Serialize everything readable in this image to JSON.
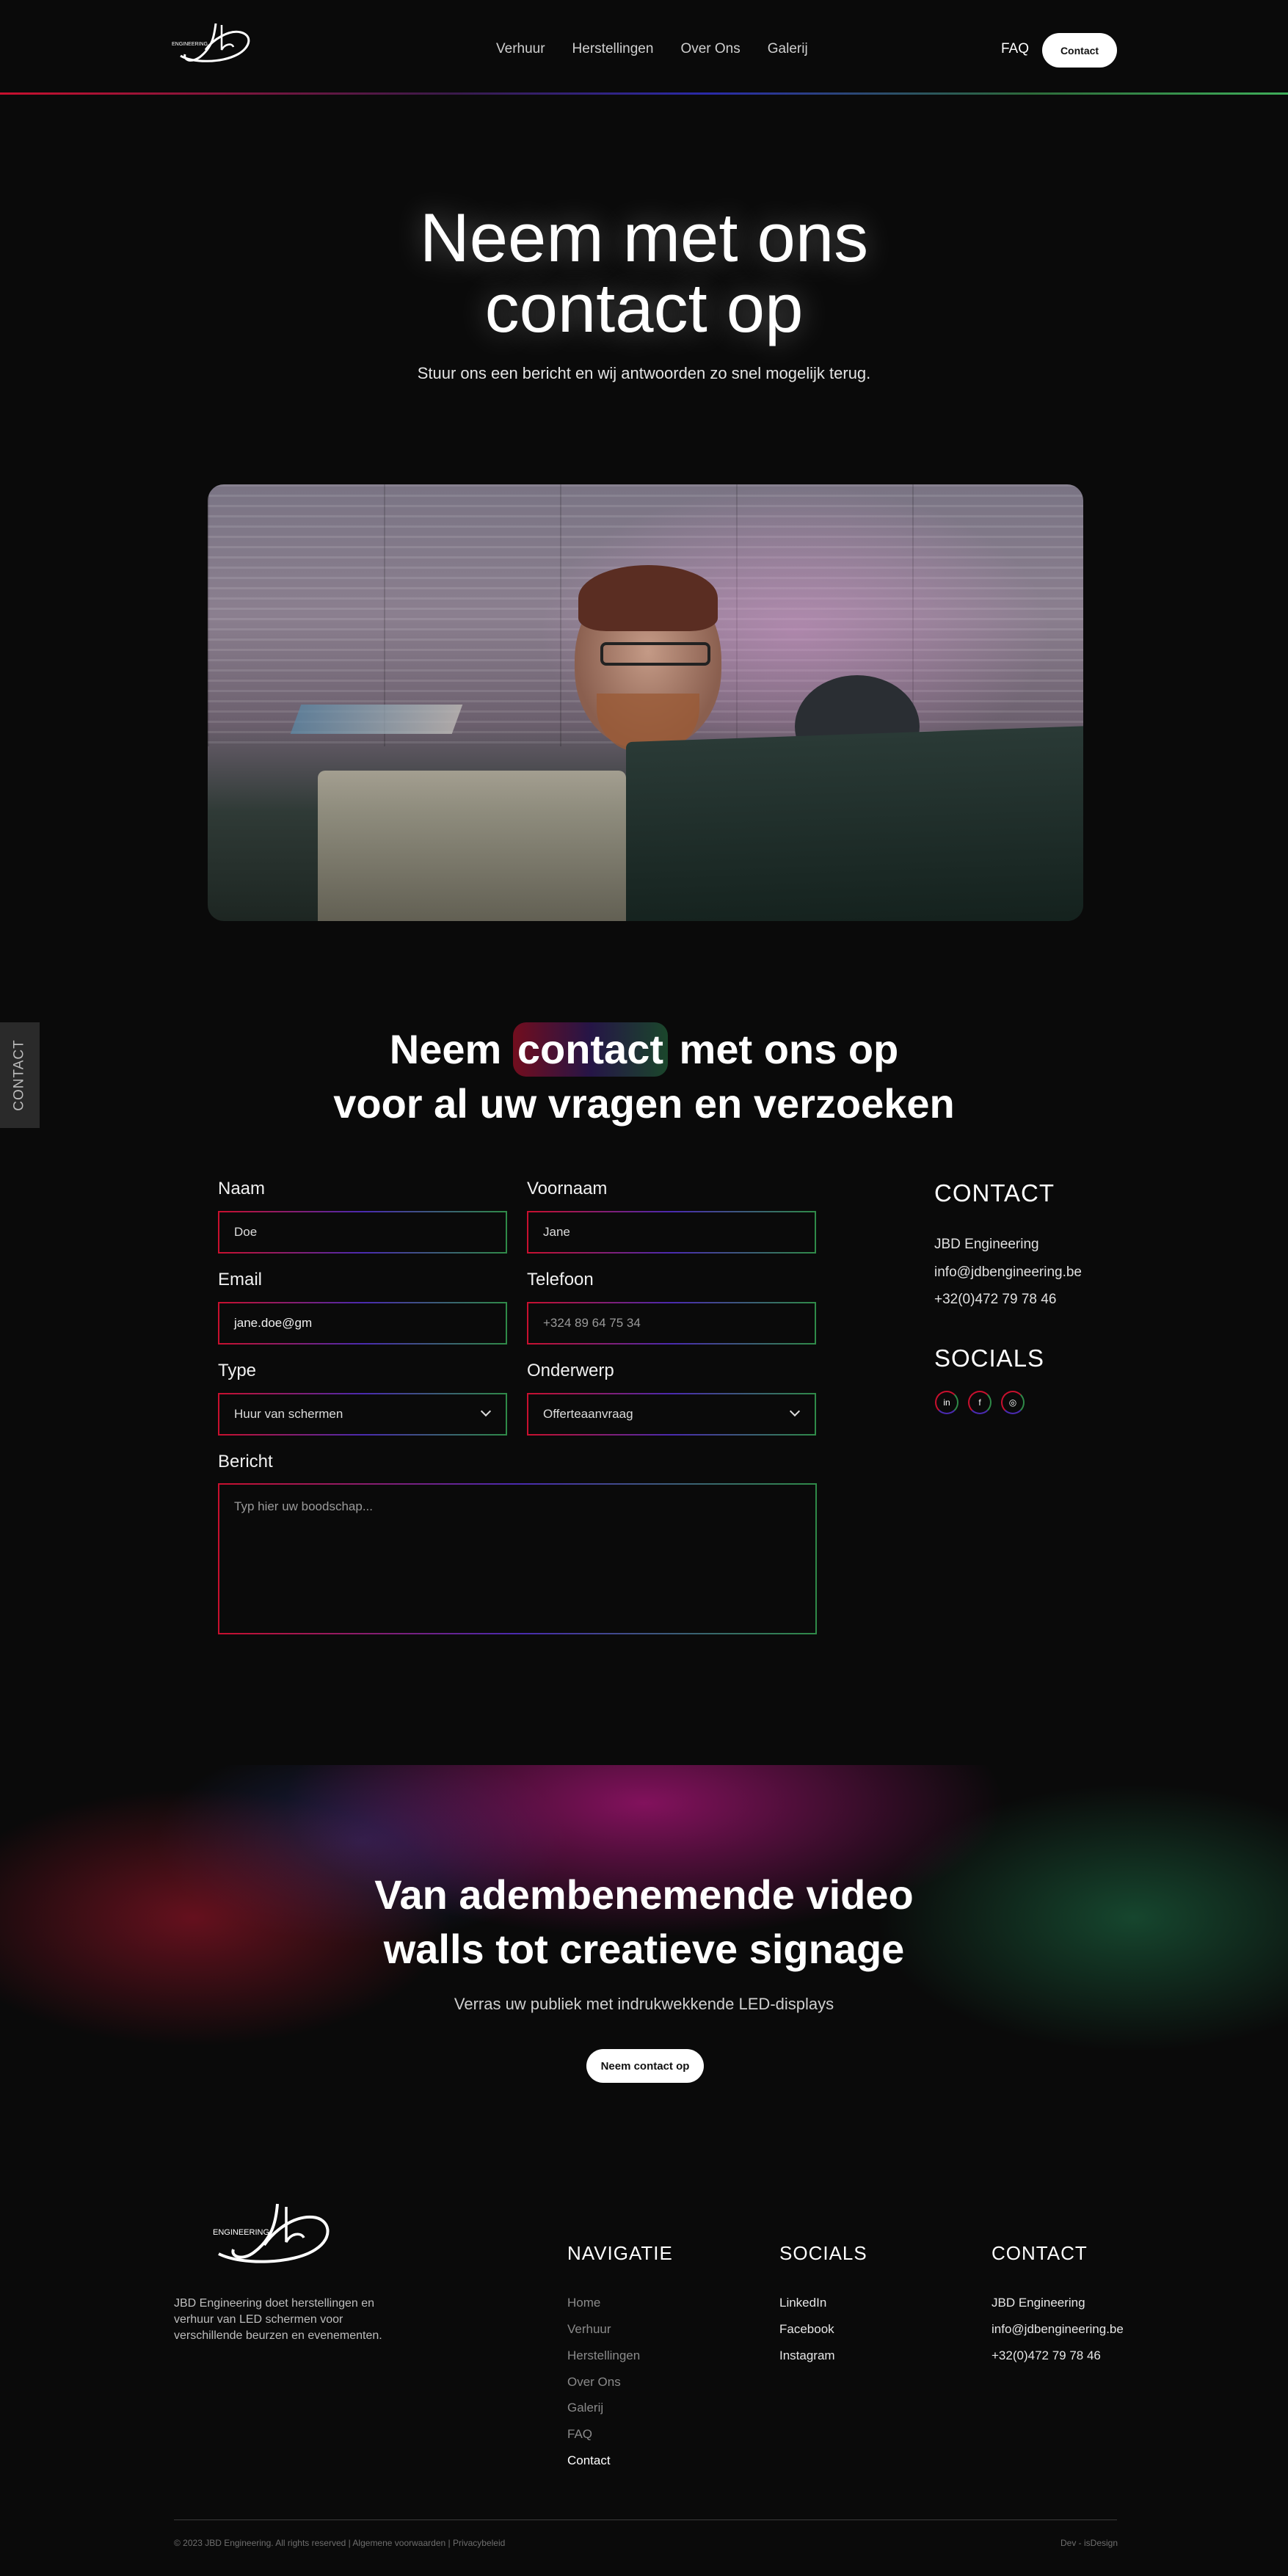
{
  "header": {
    "nav": [
      "Verhuur",
      "Herstellingen",
      "Over Ons",
      "Galerij"
    ],
    "faq": "FAQ",
    "contact_button": "Contact"
  },
  "hero": {
    "title_line1": "Neem met ons",
    "title_line2": "contact op",
    "subtitle": "Stuur ons een bericht en wij antwoorden zo snel mogelijk terug."
  },
  "side_tab": "CONTACT",
  "form_section": {
    "title_pre": "Neem ",
    "title_highlight": "contact",
    "title_post": " met ons op",
    "title_line2": "voor al uw vragen en verzoeken",
    "fields": {
      "naam": {
        "label": "Naam",
        "value": "Doe"
      },
      "voornaam": {
        "label": "Voornaam",
        "value": "Jane"
      },
      "email": {
        "label": "Email",
        "value": "jane.doe@gm"
      },
      "telefoon": {
        "label": "Telefoon",
        "value": "+324 89 64 75 34"
      },
      "type": {
        "label": "Type",
        "value": "Huur van schermen"
      },
      "onderwerp": {
        "label": "Onderwerp",
        "value": "Offerteaanvraag"
      },
      "bericht": {
        "label": "Bericht",
        "placeholder": "Typ hier uw boodschap..."
      }
    },
    "contact": {
      "heading": "CONTACT",
      "company": "JBD Engineering",
      "email": "info@jdbengineering.be",
      "phone": "+32(0)472 79 78 46"
    },
    "socials": {
      "heading": "SOCIALS",
      "icons": [
        "in",
        "f",
        "◎"
      ]
    }
  },
  "banner": {
    "title_line1": "Van adembenemende video",
    "title_line2": "walls tot creatieve signage",
    "subtitle": "Verras uw publiek met indrukwekkende LED-displays",
    "button": "Neem contact op"
  },
  "footer": {
    "logo_text": "ENGINEERING",
    "description": "JBD Engineering doet herstellingen en verhuur van LED schermen voor verschillende beurzen en evenementen.",
    "navigatie": {
      "heading": "NAVIGATIE",
      "items": [
        "Home",
        "Verhuur",
        "Herstellingen",
        "Over Ons",
        "Galerij",
        "FAQ",
        "Contact"
      ]
    },
    "socials": {
      "heading": "SOCIALS",
      "items": [
        "LinkedIn",
        "Facebook",
        "Instagram"
      ]
    },
    "contact": {
      "heading": "CONTACT",
      "items": [
        "JBD Engineering",
        "info@jdbengineering.be",
        "+32(0)472 79 78 46"
      ]
    },
    "copyright": "© 2023 JBD Engineering. All rights reserved | Algemene voorwaarden | Privacybeleid",
    "credit": "Dev - isDesign"
  },
  "colors": {
    "accent_red": "#c8102e",
    "accent_blue": "#4a2ab0",
    "accent_green": "#2f8a48",
    "background": "#0a0a0a"
  }
}
